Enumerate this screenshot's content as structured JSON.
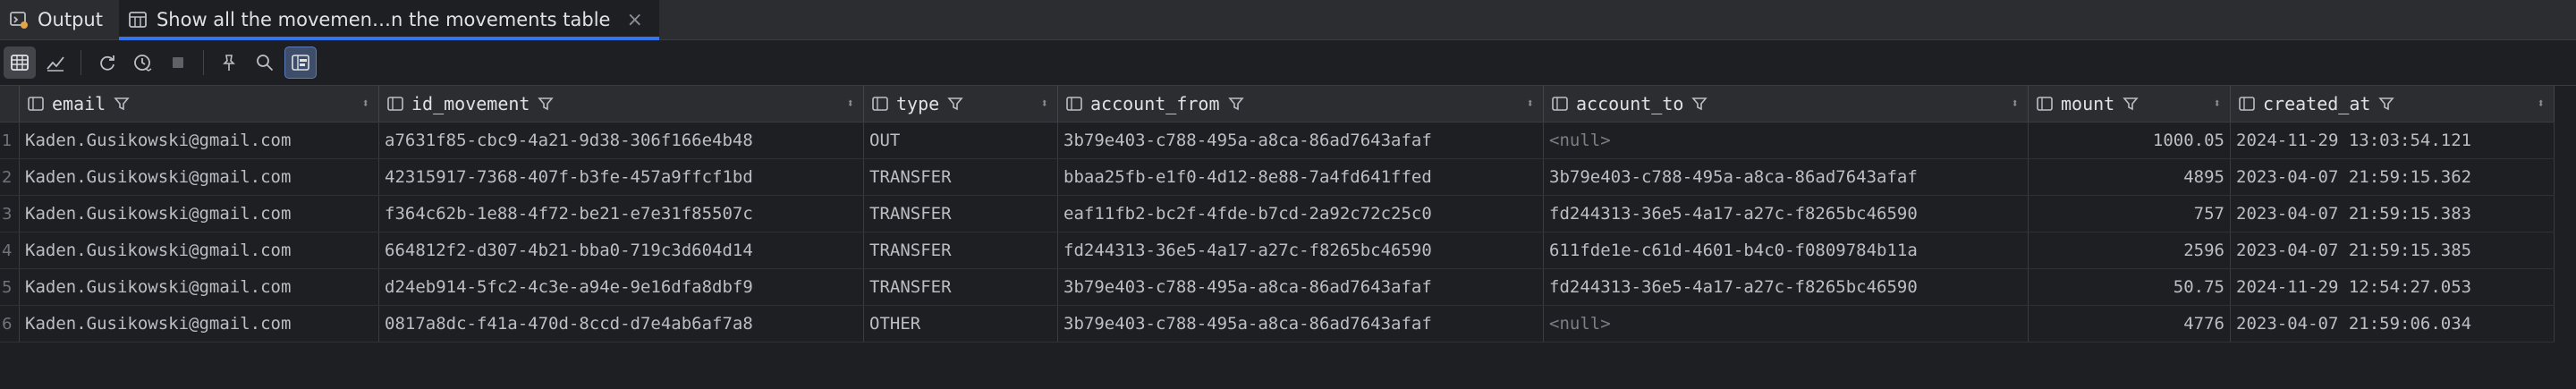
{
  "tabs": [
    {
      "label": "Output",
      "icon": "output-icon"
    },
    {
      "label": "Show all the movemen…n the movements table",
      "icon": "table-icon",
      "close": "×"
    }
  ],
  "toolbar": {
    "buttons": [
      "table-view-icon",
      "chart-icon",
      "refresh-icon",
      "history-icon",
      "stop-icon",
      "pin-icon",
      "search-icon",
      "layout-icon"
    ]
  },
  "columns": [
    "email",
    "id_movement",
    "type",
    "account_from",
    "account_to",
    "mount",
    "created_at"
  ],
  "rows": [
    {
      "num": "1",
      "email": "Kaden.Gusikowski@gmail.com",
      "id_movement": "a7631f85-cbc9-4a21-9d38-306f166e4b48",
      "type": "OUT",
      "account_from": "3b79e403-c788-495a-a8ca-86ad7643afaf",
      "account_to": "<null>",
      "mount": "1000.05",
      "created_at": "2024-11-29 13:03:54.121"
    },
    {
      "num": "2",
      "email": "Kaden.Gusikowski@gmail.com",
      "id_movement": "42315917-7368-407f-b3fe-457a9ffcf1bd",
      "type": "TRANSFER",
      "account_from": "bbaa25fb-e1f0-4d12-8e88-7a4fd641ffed",
      "account_to": "3b79e403-c788-495a-a8ca-86ad7643afaf",
      "mount": "4895",
      "created_at": "2023-04-07 21:59:15.362"
    },
    {
      "num": "3",
      "email": "Kaden.Gusikowski@gmail.com",
      "id_movement": "f364c62b-1e88-4f72-be21-e7e31f85507c",
      "type": "TRANSFER",
      "account_from": "eaf11fb2-bc2f-4fde-b7cd-2a92c72c25c0",
      "account_to": "fd244313-36e5-4a17-a27c-f8265bc46590",
      "mount": "757",
      "created_at": "2023-04-07 21:59:15.383"
    },
    {
      "num": "4",
      "email": "Kaden.Gusikowski@gmail.com",
      "id_movement": "664812f2-d307-4b21-bba0-719c3d604d14",
      "type": "TRANSFER",
      "account_from": "fd244313-36e5-4a17-a27c-f8265bc46590",
      "account_to": "611fde1e-c61d-4601-b4c0-f0809784b11a",
      "mount": "2596",
      "created_at": "2023-04-07 21:59:15.385"
    },
    {
      "num": "5",
      "email": "Kaden.Gusikowski@gmail.com",
      "id_movement": "d24eb914-5fc2-4c3e-a94e-9e16dfa8dbf9",
      "type": "TRANSFER",
      "account_from": "3b79e403-c788-495a-a8ca-86ad7643afaf",
      "account_to": "fd244313-36e5-4a17-a27c-f8265bc46590",
      "mount": "50.75",
      "created_at": "2024-11-29 12:54:27.053"
    },
    {
      "num": "6",
      "email": "Kaden.Gusikowski@gmail.com",
      "id_movement": "0817a8dc-f41a-470d-8ccd-d7e4ab6af7a8",
      "type": "OTHER",
      "account_from": "3b79e403-c788-495a-a8ca-86ad7643afaf",
      "account_to": "<null>",
      "mount": "4776",
      "created_at": "2023-04-07 21:59:06.034"
    }
  ]
}
